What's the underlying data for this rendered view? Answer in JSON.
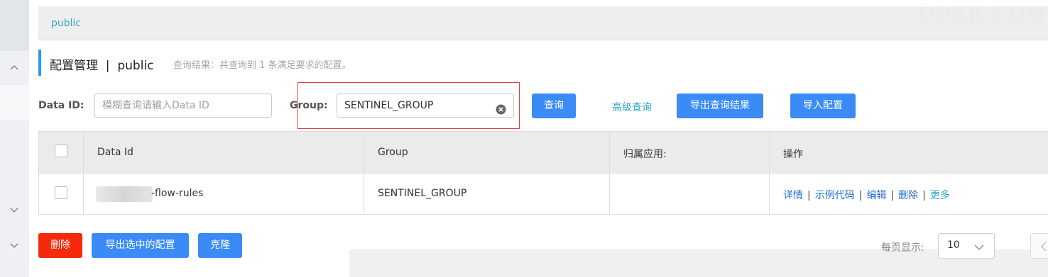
{
  "topbar": {
    "breadcrumb": "public",
    "watermark": "DDKK.COM"
  },
  "page": {
    "title": "配置管理  |  public",
    "description": "查询结果：共查询到 1 条满足要求的配置。"
  },
  "filters": {
    "data_id_label": "Data ID:",
    "data_id_placeholder": "模糊查询请输入Data ID",
    "group_label": "Group:",
    "group_value": "SENTINEL_GROUP",
    "query_button": "查询",
    "advanced_query_link": "高级查询",
    "export_results_button": "导出查询结果",
    "import_config_button": "导入配置"
  },
  "table": {
    "columns": [
      "Data Id",
      "Group",
      "归属应用:",
      "操作"
    ],
    "rows": [
      {
        "data_id": "-flow-rules",
        "group": "SENTINEL_GROUP",
        "app": "",
        "actions": [
          "详情",
          "示例代码",
          "编辑",
          "删除",
          "更多"
        ]
      }
    ]
  },
  "footer": {
    "delete_button": "删除",
    "export_selected_button": "导出选中的配置",
    "clone_button": "克隆",
    "page_size_label": "每页显示:",
    "page_size_value": "10"
  },
  "colors": {
    "primary": "#3a8bf6",
    "danger": "#f52a0a",
    "link": "#2fa8c9",
    "action_link": "#1f6fd1",
    "highlight_box": "#e03c3c"
  }
}
